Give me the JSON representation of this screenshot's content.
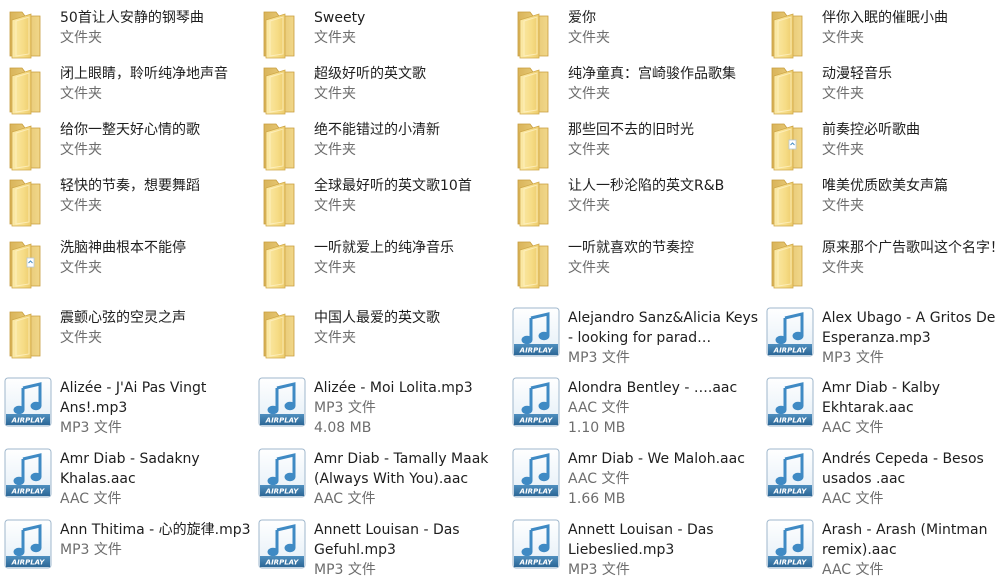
{
  "items": [
    {
      "name": "50首让人安静的钢琴曲",
      "type": "文件夹",
      "kind": "folder"
    },
    {
      "name": "Sweety",
      "type": "文件夹",
      "kind": "folder"
    },
    {
      "name": "爱你",
      "type": "文件夹",
      "kind": "folder"
    },
    {
      "name": "伴你入眠的催眠小曲",
      "type": "文件夹",
      "kind": "folder"
    },
    {
      "name": "闭上眼睛，聆听纯净地声音",
      "type": "文件夹",
      "kind": "folder"
    },
    {
      "name": "超级好听的英文歌",
      "type": "文件夹",
      "kind": "folder"
    },
    {
      "name": "纯净童真：宫崎骏作品歌集",
      "type": "文件夹",
      "kind": "folder"
    },
    {
      "name": "动漫轻音乐",
      "type": "文件夹",
      "kind": "folder"
    },
    {
      "name": "给你一整天好心情的歌",
      "type": "文件夹",
      "kind": "folder"
    },
    {
      "name": "绝不能错过的小清新",
      "type": "文件夹",
      "kind": "folder"
    },
    {
      "name": "那些回不去的旧时光",
      "type": "文件夹",
      "kind": "folder"
    },
    {
      "name": "前奏控必听歌曲",
      "type": "文件夹",
      "kind": "folder-doc"
    },
    {
      "name": "轻快的节奏，想要舞蹈",
      "type": "文件夹",
      "kind": "folder"
    },
    {
      "name": "全球最好听的英文歌10首",
      "type": "文件夹",
      "kind": "folder"
    },
    {
      "name": "让人一秒沦陷的英文R&B",
      "type": "文件夹",
      "kind": "folder"
    },
    {
      "name": "唯美优质欧美女声篇",
      "type": "文件夹",
      "kind": "folder"
    },
    {
      "name": "洗脑神曲根本不能停",
      "type": "文件夹",
      "kind": "folder-doc"
    },
    {
      "name": "一听就爱上的纯净音乐",
      "type": "文件夹",
      "kind": "folder"
    },
    {
      "name": "一听就喜欢的节奏控",
      "type": "文件夹",
      "kind": "folder"
    },
    {
      "name": "原来那个广告歌叫这个名字！",
      "type": "文件夹",
      "kind": "folder"
    },
    {
      "name": "震颤心弦的空灵之声",
      "type": "文件夹",
      "kind": "folder"
    },
    {
      "name": "中国人最爱的英文歌",
      "type": "文件夹",
      "kind": "folder"
    },
    {
      "name": "Alejandro Sanz&Alicia Keys - looking for parad…",
      "type": "MP3 文件",
      "kind": "audio"
    },
    {
      "name": "Alex Ubago - A Gritos De Esperanza.mp3",
      "type": "MP3 文件",
      "kind": "audio"
    },
    {
      "name": "Alizée - J'Ai Pas Vingt Ans!.mp3",
      "type": "MP3 文件",
      "kind": "audio"
    },
    {
      "name": "Alizée - Moi Lolita.mp3",
      "type": "MP3 文件",
      "size": "4.08 MB",
      "kind": "audio"
    },
    {
      "name": "Alondra Bentley - ….aac",
      "type": "AAC 文件",
      "size": "1.10 MB",
      "kind": "audio"
    },
    {
      "name": "Amr Diab - Kalby Ekhtarak.aac",
      "type": "AAC 文件",
      "kind": "audio"
    },
    {
      "name": "Amr Diab - Sadakny Khalas.aac",
      "type": "AAC 文件",
      "kind": "audio"
    },
    {
      "name": "Amr Diab - Tamally Maak (Always With You).aac",
      "type": "AAC 文件",
      "kind": "audio"
    },
    {
      "name": "Amr Diab - We Maloh.aac",
      "type": "AAC 文件",
      "size": "1.66 MB",
      "kind": "audio"
    },
    {
      "name": "Andrés Cepeda - Besos usados        .aac",
      "type": "AAC 文件",
      "kind": "audio"
    },
    {
      "name": "Ann Thitima - 心的旋律.mp3",
      "type": "MP3 文件",
      "kind": "audio"
    },
    {
      "name": "Annett Louisan - Das Gefuhl.mp3",
      "type": "MP3 文件",
      "kind": "audio"
    },
    {
      "name": "Annett Louisan - Das Liebeslied.mp3",
      "type": "MP3 文件",
      "kind": "audio"
    },
    {
      "name": "Arash - Arash (Mintman remix).aac",
      "type": "AAC 文件",
      "kind": "audio"
    }
  ],
  "airplay_label": "AIRPLAY"
}
